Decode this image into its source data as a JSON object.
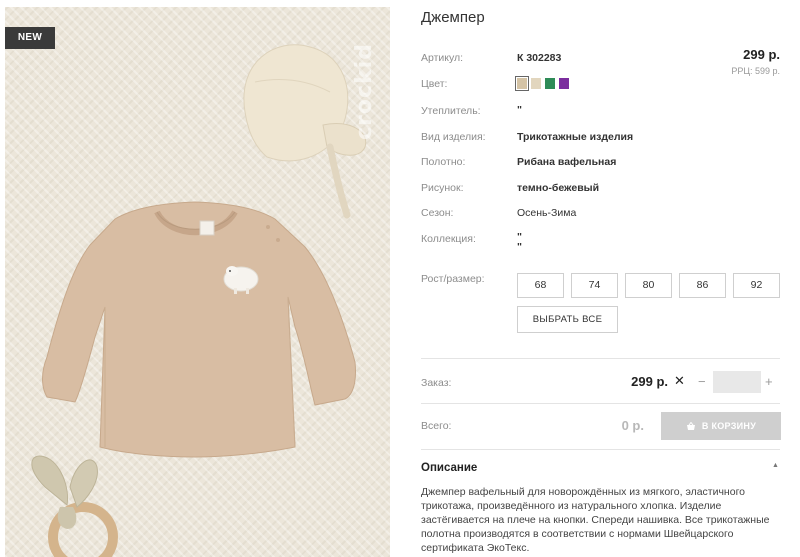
{
  "product": {
    "badge": "NEW",
    "brand_watermark": "crockid",
    "title": "Джемпер",
    "price": "299 р.",
    "rrp": "РРЦ: 599 р."
  },
  "specs": {
    "article": {
      "label": "Артикул:",
      "value": "К 302283"
    },
    "color": {
      "label": "Цвет:"
    },
    "insulation": {
      "label": "Утеплитель:",
      "value": "\""
    },
    "type": {
      "label": "Вид изделия:",
      "value": "Трикотажные изделия"
    },
    "fabric": {
      "label": "Полотно:",
      "value": "Рибана вафельная"
    },
    "pattern": {
      "label": "Рисунок:",
      "value": "темно-бежевый"
    },
    "season": {
      "label": "Сезон:",
      "value": "Осень-Зима"
    },
    "collection": {
      "label": "Коллекция:",
      "value_1": "\"",
      "value_2": "\""
    }
  },
  "color_swatches": [
    {
      "color": "#d4c3a5",
      "active": true
    },
    {
      "color": "#e2d6be",
      "active": false
    },
    {
      "color": "#2e8b57",
      "active": false
    },
    {
      "color": "#7b2d9e",
      "active": false
    }
  ],
  "sizes": {
    "label": "Рост/размер:",
    "options": [
      "68",
      "74",
      "80",
      "86",
      "92"
    ],
    "select_all": "ВЫБРАТЬ ВСЕ"
  },
  "order": {
    "label": "Заказ:",
    "price": "299 р.",
    "times": "✕",
    "minus": "−",
    "plus": "+",
    "quantity": ""
  },
  "total": {
    "label": "Всего:",
    "value": "0 р.",
    "cart_button": "В КОРЗИНУ"
  },
  "description": {
    "title": "Описание",
    "toggle": "▲",
    "text": "Джемпер вафельный для новорождённых из мягкого, эластичного трикотажа, произведённого из натурального хлопка. Изделие застёгивается на плече на кнопки. Спереди нашивка. Все трикотажные полотна производятся в соответствии с нормами Швейцарского сертификата ЭкоТекс."
  },
  "colors": {
    "sweater": "#d8bda3",
    "background": "#ece6da",
    "cart_disabled": "#cfcfcf"
  }
}
